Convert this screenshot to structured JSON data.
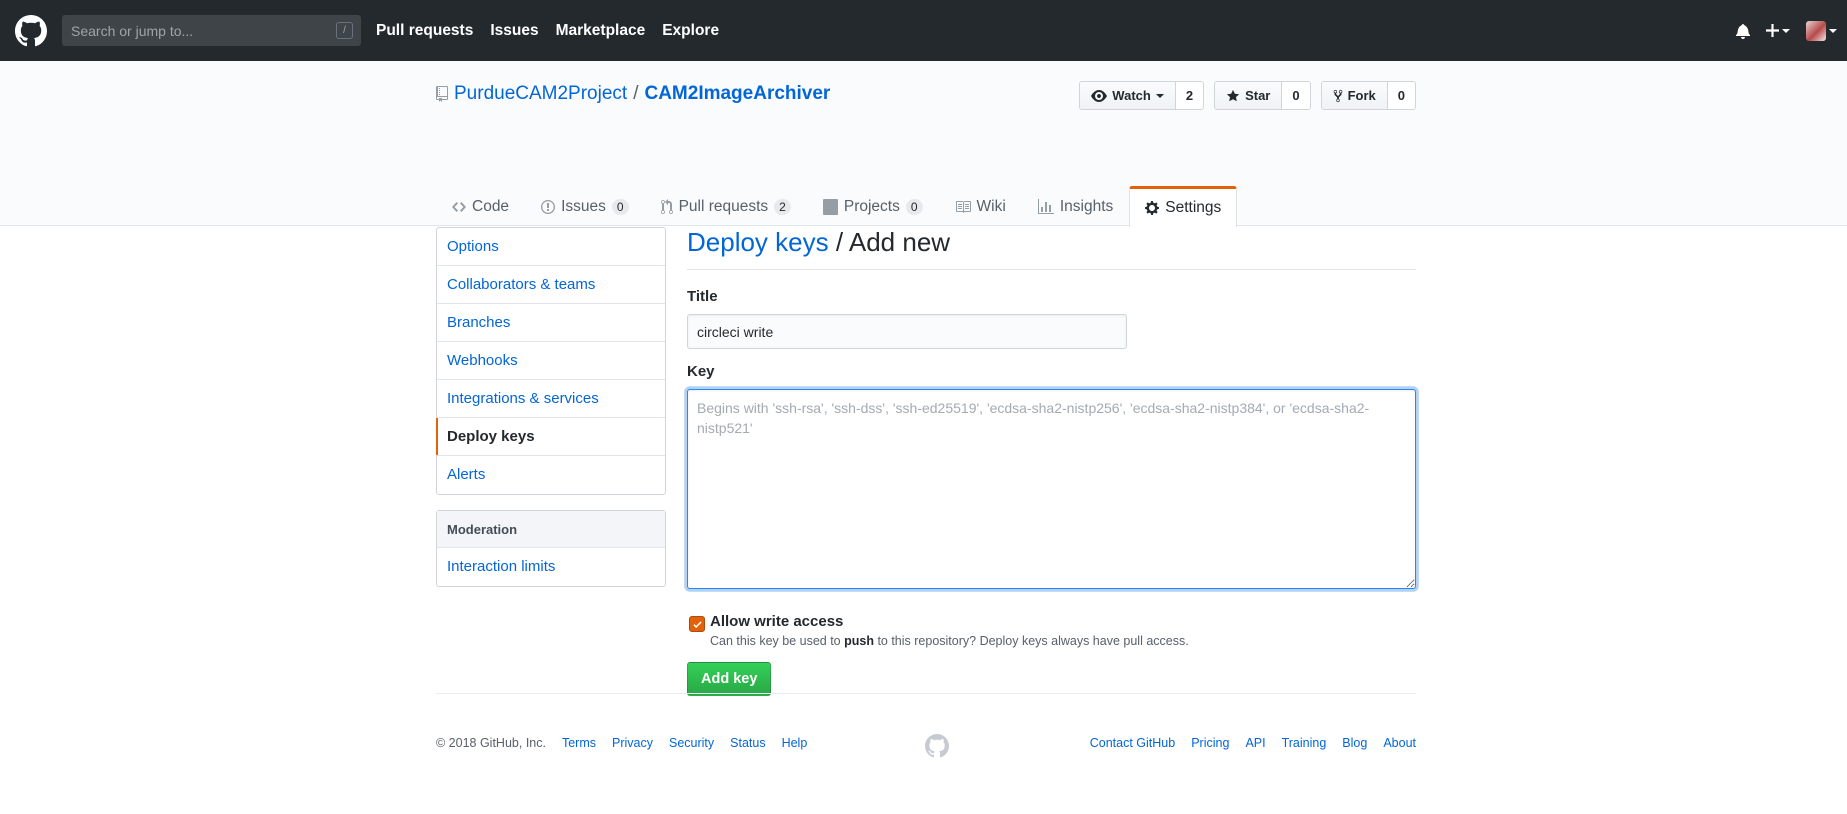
{
  "header": {
    "search_placeholder": "Search or jump to...",
    "search_shortcut": "/",
    "nav": [
      "Pull requests",
      "Issues",
      "Marketplace",
      "Explore"
    ]
  },
  "repo": {
    "owner": "PurdueCAM2Project",
    "separator": "/",
    "name": "CAM2ImageArchiver",
    "watch_label": "Watch",
    "watch_count": "2",
    "star_label": "Star",
    "star_count": "0",
    "fork_label": "Fork",
    "fork_count": "0"
  },
  "tabs": [
    {
      "label": "Code",
      "counter": ""
    },
    {
      "label": "Issues",
      "counter": "0"
    },
    {
      "label": "Pull requests",
      "counter": "2"
    },
    {
      "label": "Projects",
      "counter": "0"
    },
    {
      "label": "Wiki",
      "counter": ""
    },
    {
      "label": "Insights",
      "counter": ""
    },
    {
      "label": "Settings",
      "counter": ""
    }
  ],
  "sidebar": {
    "items": [
      "Options",
      "Collaborators & teams",
      "Branches",
      "Webhooks",
      "Integrations & services",
      "Deploy keys",
      "Alerts"
    ],
    "selected": "Deploy keys",
    "moderation_heading": "Moderation",
    "moderation_items": [
      "Interaction limits"
    ]
  },
  "form": {
    "breadcrumb_link": "Deploy keys",
    "breadcrumb_rest": "/ Add new",
    "title_label": "Title",
    "title_value": "circleci write",
    "key_label": "Key",
    "key_placeholder": "Begins with 'ssh-rsa', 'ssh-dss', 'ssh-ed25519', 'ecdsa-sha2-nistp256', 'ecdsa-sha2-nistp384', or 'ecdsa-sha2-nistp521'",
    "write_access_label": "Allow write access",
    "write_access_checked": true,
    "write_note_pre": "Can this key be used to ",
    "write_note_bold": "push",
    "write_note_post": " to this repository? Deploy keys always have pull access.",
    "submit_label": "Add key"
  },
  "footer": {
    "copyright": "© 2018 GitHub, Inc.",
    "left_links": [
      "Terms",
      "Privacy",
      "Security",
      "Status",
      "Help"
    ],
    "right_links": [
      "Contact GitHub",
      "Pricing",
      "API",
      "Training",
      "Blog",
      "About"
    ]
  },
  "colors": {
    "header_bg": "#24292e",
    "link": "#0366d6",
    "accent_orange": "#e36209",
    "primary_green": "#28a745"
  }
}
